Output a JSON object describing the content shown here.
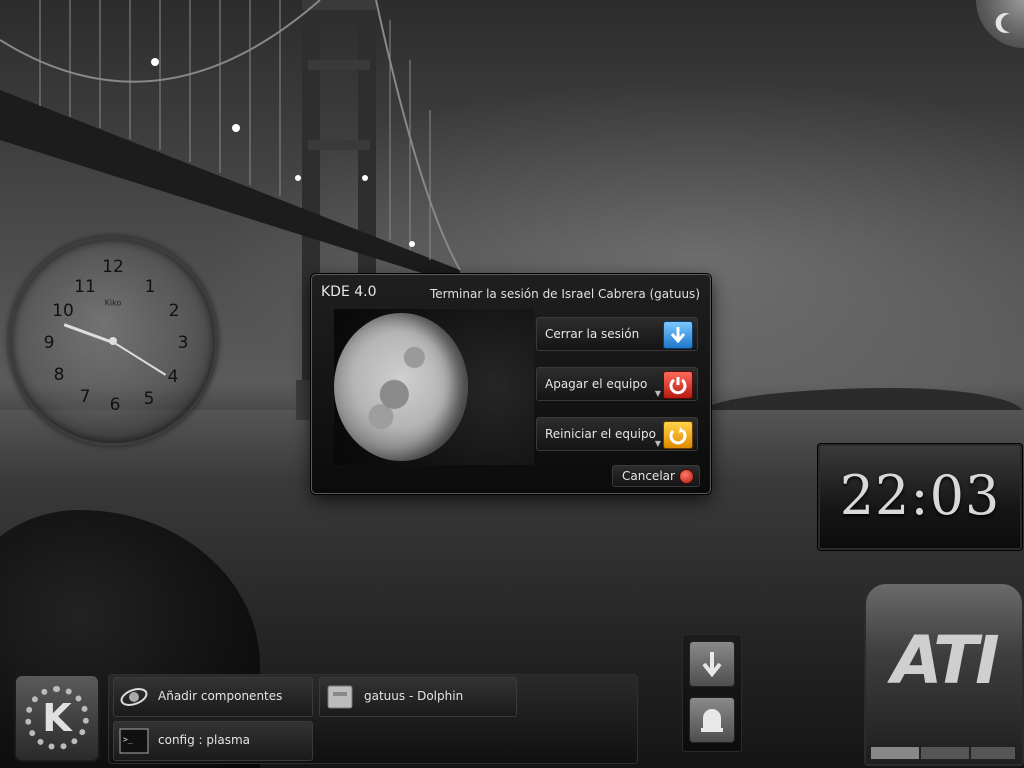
{
  "dialog": {
    "product": "KDE 4.0",
    "title": "Terminar la sesión de Israel Cabrera (gatuus)",
    "options": [
      {
        "label": "Cerrar la sesión",
        "icon": "logout-arrow-icon",
        "color": "#2a8ee0"
      },
      {
        "label": "Apagar el equipo",
        "icon": "power-icon",
        "color": "#d02a1a"
      },
      {
        "label": "Reiniciar el equipo",
        "icon": "restart-icon",
        "color": "#f0a200"
      }
    ],
    "cancel_label": "Cancelar"
  },
  "analog_clock": {
    "brand": "Kiko",
    "numbers": [
      "12",
      "1",
      "2",
      "3",
      "4",
      "5",
      "6",
      "7",
      "8",
      "9",
      "10",
      "11"
    ]
  },
  "digital_clock": {
    "time": "22:03"
  },
  "ati_widget": {
    "logo": "ATI"
  },
  "taskbar": {
    "tasks": [
      {
        "label": "Añadir componentes",
        "icon": "add-widgets-icon"
      },
      {
        "label": "gatuus - Dolphin",
        "icon": "dolphin-drawer-icon"
      },
      {
        "label": "config : plasma",
        "icon": "terminal-icon"
      }
    ]
  }
}
